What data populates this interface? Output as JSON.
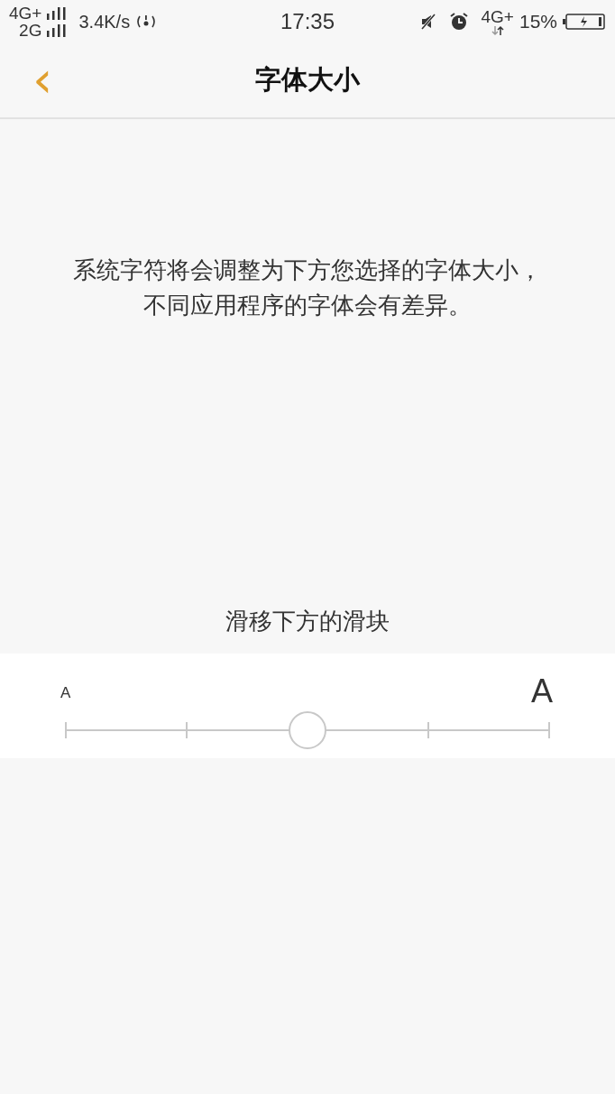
{
  "status_bar": {
    "network_1": "4G+",
    "network_2": "2G",
    "speed": "3.4K/s",
    "time": "17:35",
    "data_network": "4G+",
    "battery": "15%"
  },
  "header": {
    "back": "‹",
    "title": "字体大小"
  },
  "description": [
    "系统字符将会调整为下方您选择的字体大小，",
    "不同应用程序的字体会有差异。"
  ],
  "slider_hint": "滑移下方的滑块",
  "slider": {
    "small_label": "A",
    "large_label": "A",
    "level": 0.5
  }
}
